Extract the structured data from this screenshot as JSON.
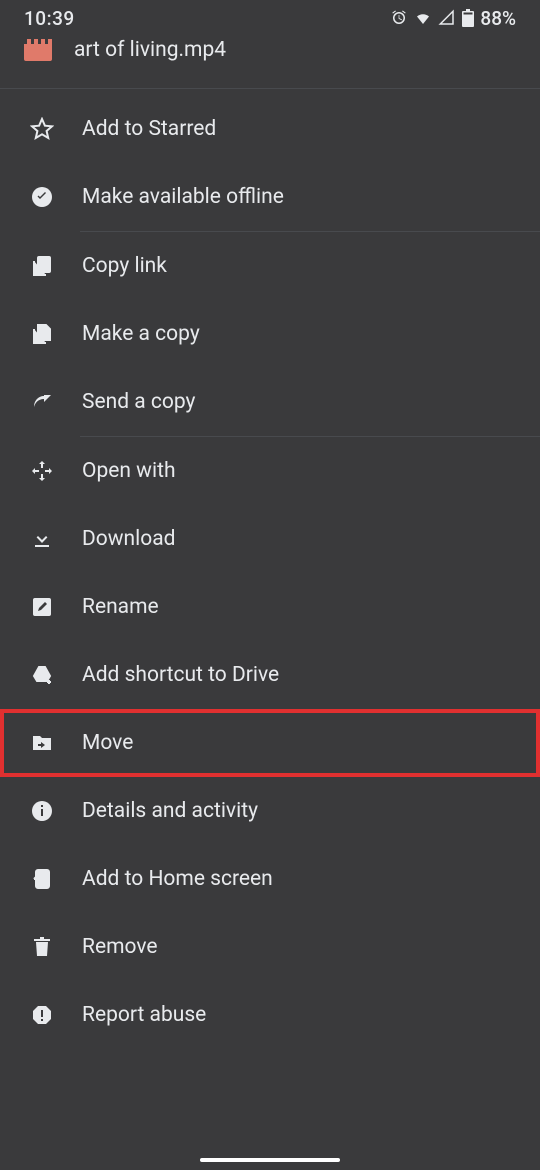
{
  "statusBar": {
    "time": "10:39",
    "battery": "88%"
  },
  "header": {
    "filename": "art of living.mp4"
  },
  "menu": {
    "addToStarred": "Add to Starred",
    "makeOffline": "Make available offline",
    "copyLink": "Copy link",
    "makeCopy": "Make a copy",
    "sendCopy": "Send a copy",
    "openWith": "Open with",
    "download": "Download",
    "rename": "Rename",
    "addShortcut": "Add shortcut to Drive",
    "move": "Move",
    "details": "Details and activity",
    "addHome": "Add to Home screen",
    "remove": "Remove",
    "reportAbuse": "Report abuse"
  }
}
